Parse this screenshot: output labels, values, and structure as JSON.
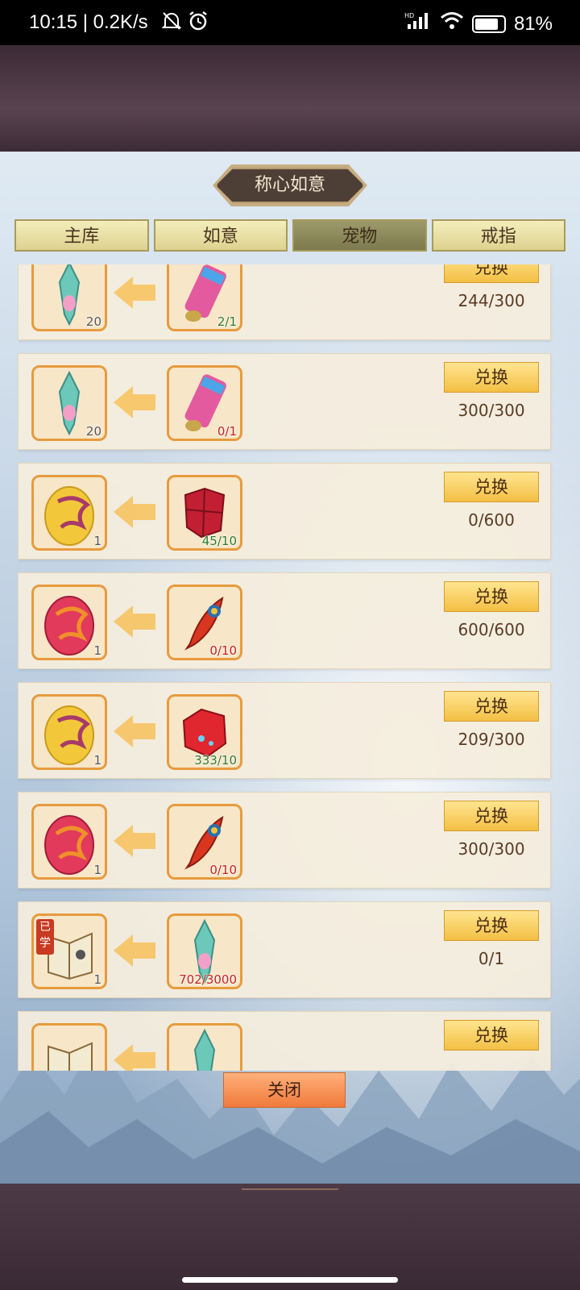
{
  "status_bar": {
    "time": "10:15 | 0.2K/s",
    "battery": "81%",
    "icons": [
      "mute-bell-icon",
      "alarm-icon",
      "hd-signal-icon",
      "wifi-icon",
      "battery-icon"
    ]
  },
  "dialog": {
    "title": "称心如意",
    "close_label": "关闭"
  },
  "tabs": [
    {
      "label": "主库",
      "active": false
    },
    {
      "label": "如意",
      "active": false
    },
    {
      "label": "宠物",
      "active": true
    },
    {
      "label": "戒指",
      "active": false
    }
  ],
  "exchange_rows": [
    {
      "reward_icon": "jade-sword-icon",
      "reward_count": "20",
      "cost_icon": "scroll-icon",
      "cost_count": "2/1",
      "cost_status": "green",
      "button": "兑换",
      "progress": "244/300"
    },
    {
      "reward_icon": "jade-sword-icon",
      "reward_count": "20",
      "cost_icon": "scroll-icon",
      "cost_count": "0/1",
      "cost_status": "red",
      "button": "兑换",
      "progress": "300/300"
    },
    {
      "reward_icon": "golden-dragon-egg-icon",
      "reward_count": "1",
      "cost_icon": "red-crystal-icon",
      "cost_count": "45/10",
      "cost_status": "green",
      "button": "兑换",
      "progress": "0/600"
    },
    {
      "reward_icon": "red-dragon-egg-icon",
      "reward_count": "1",
      "cost_icon": "phoenix-feather-icon",
      "cost_count": "0/10",
      "cost_status": "red",
      "button": "兑换",
      "progress": "600/600"
    },
    {
      "reward_icon": "golden-dragon-egg-icon",
      "reward_count": "1",
      "cost_icon": "ruby-ore-icon",
      "cost_count": "333/10",
      "cost_status": "green",
      "button": "兑换",
      "progress": "209/300"
    },
    {
      "reward_icon": "red-dragon-egg-icon",
      "reward_count": "1",
      "cost_icon": "phoenix-feather-icon",
      "cost_count": "0/10",
      "cost_status": "red",
      "button": "兑换",
      "progress": "300/300"
    },
    {
      "reward_icon": "skill-book-icon",
      "reward_count": "1",
      "reward_badge": "已学",
      "cost_icon": "jade-sword-icon",
      "cost_count": "702/3000",
      "cost_status": "red",
      "button": "兑换",
      "progress": "0/1"
    },
    {
      "reward_icon": "skill-book-icon",
      "reward_count": "",
      "cost_icon": "jade-sword-icon",
      "cost_count": "",
      "cost_status": "red",
      "button": "兑换",
      "progress": ""
    }
  ]
}
